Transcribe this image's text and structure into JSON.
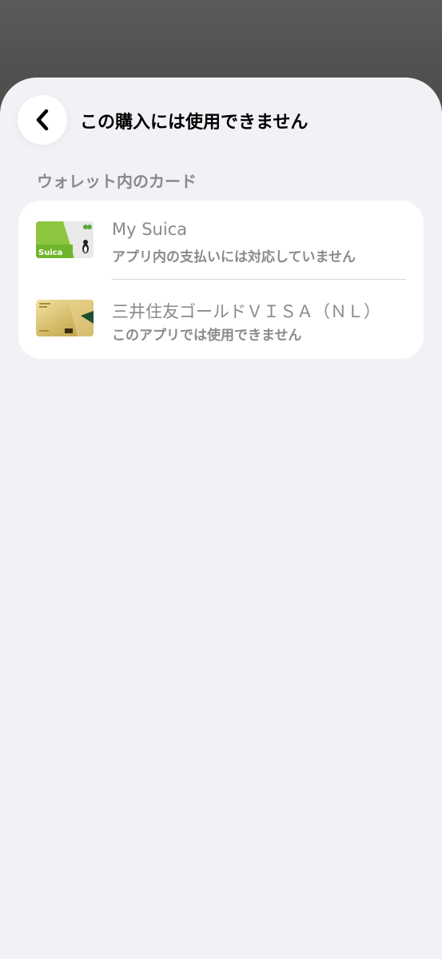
{
  "header": {
    "title": "この購入には使用できません",
    "back_icon": "chevron-left-icon"
  },
  "section": {
    "label": "ウォレット内のカード"
  },
  "cards": [
    {
      "name": "My Suica",
      "status": "アプリ内の支払いには対応していません",
      "thumbnail": "suica-card-icon",
      "thumbnail_text": "Suica",
      "accent": "#8cc63f"
    },
    {
      "name": "三井住友ゴールドＶＩＳＡ（ＮＬ）",
      "status": "このアプリでは使用できません",
      "thumbnail": "gold-visa-card-icon",
      "accent": "#d8c27a"
    }
  ],
  "colors": {
    "background_dim": "#535351",
    "sheet": "#f1f1f6",
    "card_group": "#ffffff",
    "secondary_text": "#8a8a8e"
  }
}
